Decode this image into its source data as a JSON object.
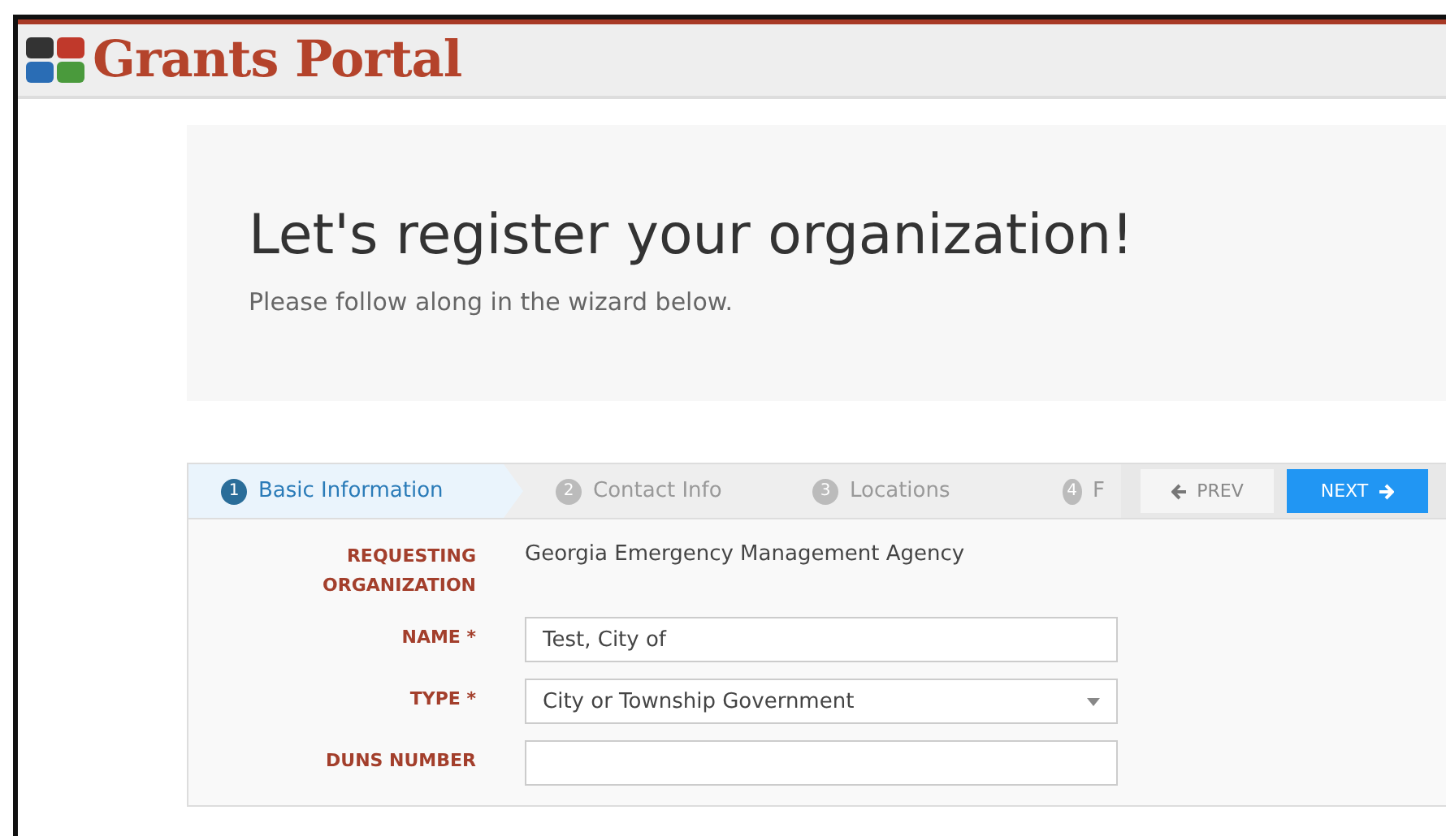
{
  "header": {
    "title": "Grants Portal"
  },
  "hero": {
    "title": "Let's register your organization!",
    "subtitle": "Please follow along in the wizard below."
  },
  "wizard": {
    "steps": [
      {
        "number": "1",
        "label": "Basic Information",
        "selected": true
      },
      {
        "number": "2",
        "label": "Contact Info",
        "selected": false
      },
      {
        "number": "3",
        "label": "Locations",
        "selected": false
      },
      {
        "number": "4",
        "label": "F",
        "selected": false
      }
    ],
    "buttons": [
      {
        "kind": "prev",
        "label": "PREV"
      },
      {
        "kind": "next",
        "label": "NEXT"
      }
    ]
  },
  "form": {
    "fields": [
      {
        "kind": "static",
        "label": "REQUESTING ORGANIZATION",
        "value": "Georgia Emergency Management Agency"
      },
      {
        "kind": "text",
        "label": "NAME *",
        "value": "Test, City of"
      },
      {
        "kind": "select",
        "label": "TYPE *",
        "value": "City or Township Government"
      },
      {
        "kind": "text",
        "label": "DUNS NUMBER"
      }
    ]
  }
}
